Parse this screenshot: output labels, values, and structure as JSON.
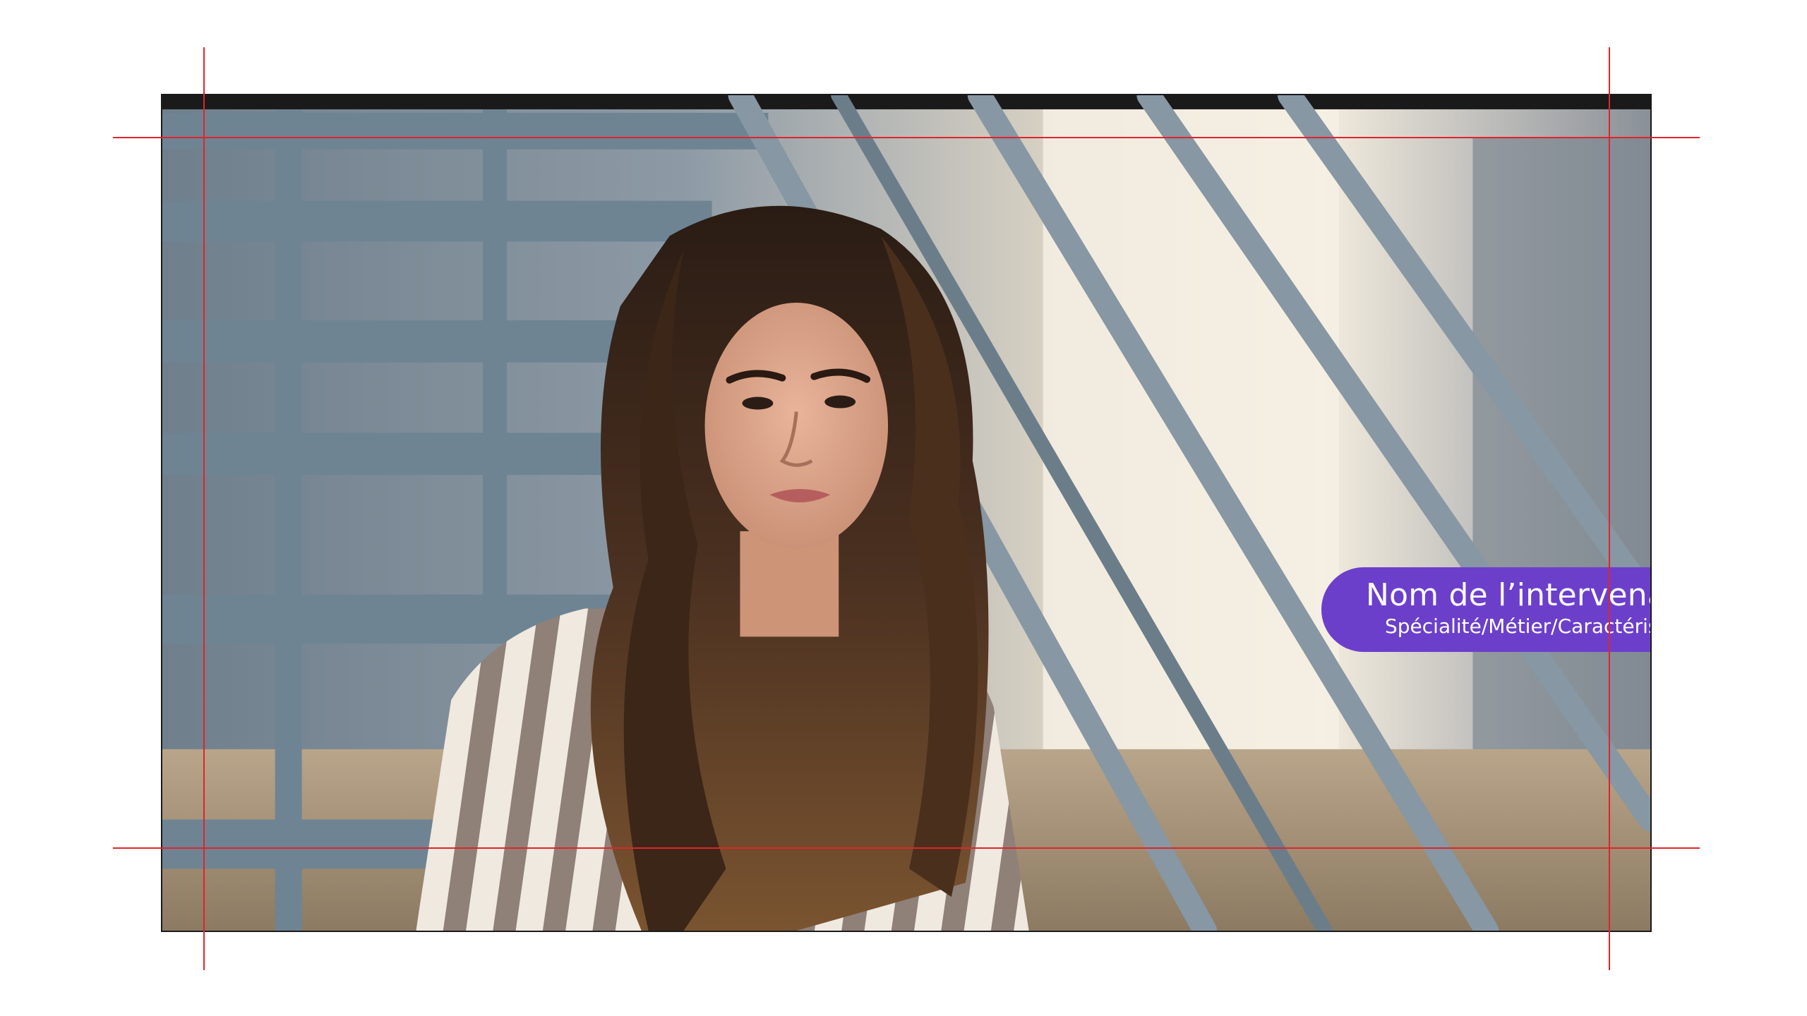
{
  "lower_third": {
    "name": "Nom de l’intervenant·e",
    "role": "Spécialité/Métier/Caractéristique",
    "background_color": "#6C3FCB",
    "text_color": "#FFFFFF"
  },
  "guides": {
    "color": "#E0242C"
  },
  "photo": {
    "subject": "woman-with-long-hair-seated-on-metal-staircase"
  }
}
